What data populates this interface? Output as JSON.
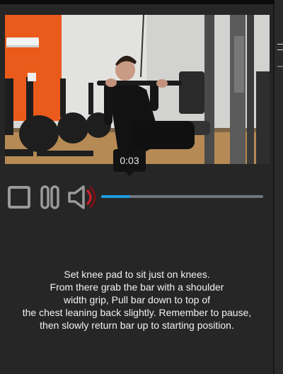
{
  "video": {
    "current_time": "0:03",
    "progress": 0.18,
    "progress_color": "#1d9be2",
    "muted_indicator_color": "#c0202a"
  },
  "controls": {
    "stop_icon": "stop-icon",
    "pause_icon": "pause-icon",
    "volume_icon": "volume-icon"
  },
  "exercise": {
    "description": "Set knee pad to sit just on knees.\nFrom there grab the bar with a shoulder\nwidth grip, Pull bar down to top of\nthe chest leaning back slightly. Remember to pause,\nthen slowly return bar up to starting position."
  }
}
